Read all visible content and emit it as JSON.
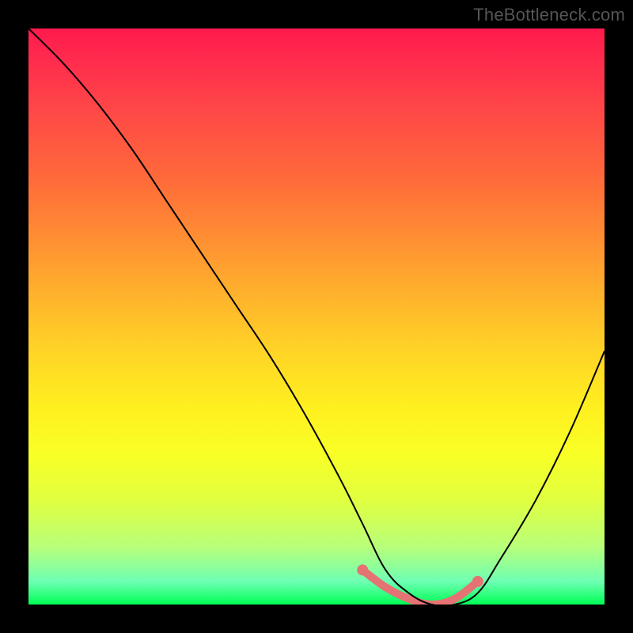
{
  "watermark": "TheBottleneck.com",
  "chart_data": {
    "type": "line",
    "title": "",
    "xlabel": "",
    "ylabel": "",
    "xlim": [
      0,
      100
    ],
    "ylim": [
      0,
      100
    ],
    "grid": false,
    "legend": false,
    "series": [
      {
        "name": "bottleneck-curve",
        "x": [
          0,
          6,
          12,
          18,
          24,
          30,
          36,
          42,
          48,
          54,
          58,
          62,
          66,
          70,
          74,
          78,
          82,
          88,
          94,
          100
        ],
        "values": [
          100,
          94,
          87,
          79,
          70,
          61,
          52,
          43,
          33,
          22,
          14,
          6,
          2,
          0,
          0,
          2,
          8,
          18,
          30,
          44
        ]
      }
    ],
    "highlight": {
      "name": "optimal-range",
      "x": [
        58,
        62,
        66,
        70,
        74,
        78
      ],
      "values": [
        6,
        3,
        1,
        0,
        1,
        4
      ]
    },
    "background_gradient": {
      "top": "#ff1a4d",
      "middle": "#fff01f",
      "bottom": "#00ff55"
    }
  }
}
